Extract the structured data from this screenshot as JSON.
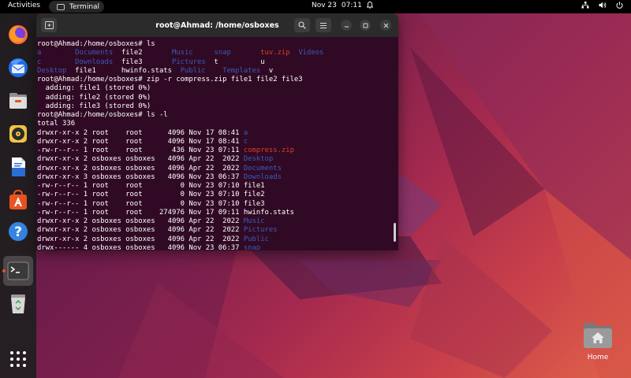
{
  "topbar": {
    "activities": "Activities",
    "app_name": "Terminal",
    "date": "Nov 23",
    "time": "07:11"
  },
  "dock": {
    "items": [
      "firefox-icon",
      "thunderbird-icon",
      "files-icon",
      "rhythmbox-icon",
      "writer-icon",
      "software-icon",
      "help-icon",
      "terminal-icon",
      "trash-icon",
      "app-grid-icon"
    ]
  },
  "terminal": {
    "title": "root@Ahmad: /home/osboxes",
    "lines": [
      [
        {
          "t": "root@Ahmad:/home/osboxes# ls",
          "c": ""
        }
      ],
      [
        {
          "t": "a        ",
          "c": "dir"
        },
        {
          "t": "Documents",
          "c": "dir"
        },
        {
          "t": "  file2       ",
          "c": ""
        },
        {
          "t": "Music",
          "c": "dir"
        },
        {
          "t": "     ",
          "c": ""
        },
        {
          "t": "snap",
          "c": "dir"
        },
        {
          "t": "       ",
          "c": ""
        },
        {
          "t": "tuv.zip",
          "c": "red"
        },
        {
          "t": "  ",
          "c": ""
        },
        {
          "t": "Videos",
          "c": "dir"
        }
      ],
      [
        {
          "t": "c        ",
          "c": "dir"
        },
        {
          "t": "Downloads",
          "c": "dir"
        },
        {
          "t": "  file3       ",
          "c": ""
        },
        {
          "t": "Pictures",
          "c": "dir"
        },
        {
          "t": "  t          u",
          "c": ""
        }
      ],
      [
        {
          "t": "Desktop",
          "c": "dir"
        },
        {
          "t": "  file1      hwinfo.stats  ",
          "c": ""
        },
        {
          "t": "Public",
          "c": "dir"
        },
        {
          "t": "    ",
          "c": ""
        },
        {
          "t": "Templates",
          "c": "dir"
        },
        {
          "t": "  v",
          "c": ""
        }
      ],
      [
        {
          "t": "root@Ahmad:/home/osboxes# zip -r compress.zip file1 file2 file3",
          "c": ""
        }
      ],
      [
        {
          "t": "  adding: file1 (stored 0%)",
          "c": ""
        }
      ],
      [
        {
          "t": "  adding: file2 (stored 0%)",
          "c": ""
        }
      ],
      [
        {
          "t": "  adding: file3 (stored 0%)",
          "c": ""
        }
      ],
      [
        {
          "t": "root@Ahmad:/home/osboxes# ls -l",
          "c": ""
        }
      ],
      [
        {
          "t": "total 336",
          "c": ""
        }
      ],
      [
        {
          "t": "drwxr-xr-x 2 root    root      4096 Nov 17 08:41 ",
          "c": ""
        },
        {
          "t": "a",
          "c": "dir"
        }
      ],
      [
        {
          "t": "drwxr-xr-x 2 root    root      4096 Nov 17 08:41 ",
          "c": ""
        },
        {
          "t": "c",
          "c": "dir"
        }
      ],
      [
        {
          "t": "-rw-r--r-- 1 root    root       436 Nov 23 07:11 ",
          "c": ""
        },
        {
          "t": "compress.zip",
          "c": "red"
        }
      ],
      [
        {
          "t": "drwxr-xr-x 2 osboxes osboxes   4096 Apr 22  2022 ",
          "c": ""
        },
        {
          "t": "Desktop",
          "c": "dir"
        }
      ],
      [
        {
          "t": "drwxr-xr-x 2 osboxes osboxes   4096 Apr 22  2022 ",
          "c": ""
        },
        {
          "t": "Documents",
          "c": "dir"
        }
      ],
      [
        {
          "t": "drwxr-xr-x 3 osboxes osboxes   4096 Nov 23 06:37 ",
          "c": ""
        },
        {
          "t": "Downloads",
          "c": "dir"
        }
      ],
      [
        {
          "t": "-rw-r--r-- 1 root    root         0 Nov 23 07:10 file1",
          "c": ""
        }
      ],
      [
        {
          "t": "-rw-r--r-- 1 root    root         0 Nov 23 07:10 file2",
          "c": ""
        }
      ],
      [
        {
          "t": "-rw-r--r-- 1 root    root         0 Nov 23 07:10 file3",
          "c": ""
        }
      ],
      [
        {
          "t": "-rw-r--r-- 1 root    root    274976 Nov 17 09:11 hwinfo.stats",
          "c": ""
        }
      ],
      [
        {
          "t": "drwxr-xr-x 2 osboxes osboxes   4096 Apr 22  2022 ",
          "c": ""
        },
        {
          "t": "Music",
          "c": "dir"
        }
      ],
      [
        {
          "t": "drwxr-xr-x 2 osboxes osboxes   4096 Apr 22  2022 ",
          "c": ""
        },
        {
          "t": "Pictures",
          "c": "dir"
        }
      ],
      [
        {
          "t": "drwxr-xr-x 2 osboxes osboxes   4096 Apr 22  2022 ",
          "c": ""
        },
        {
          "t": "Public",
          "c": "dir"
        }
      ],
      [
        {
          "t": "drwx------ 4 osboxes osboxes   4096 Nov 23 06:37 ",
          "c": ""
        },
        {
          "t": "snap",
          "c": "dir"
        }
      ]
    ]
  },
  "desktop": {
    "home_label": "Home"
  },
  "colors": {
    "terminal_bg": "#300a24",
    "dir": "#3b5ab8",
    "archive": "#e0392b",
    "accent": "#e95420"
  }
}
